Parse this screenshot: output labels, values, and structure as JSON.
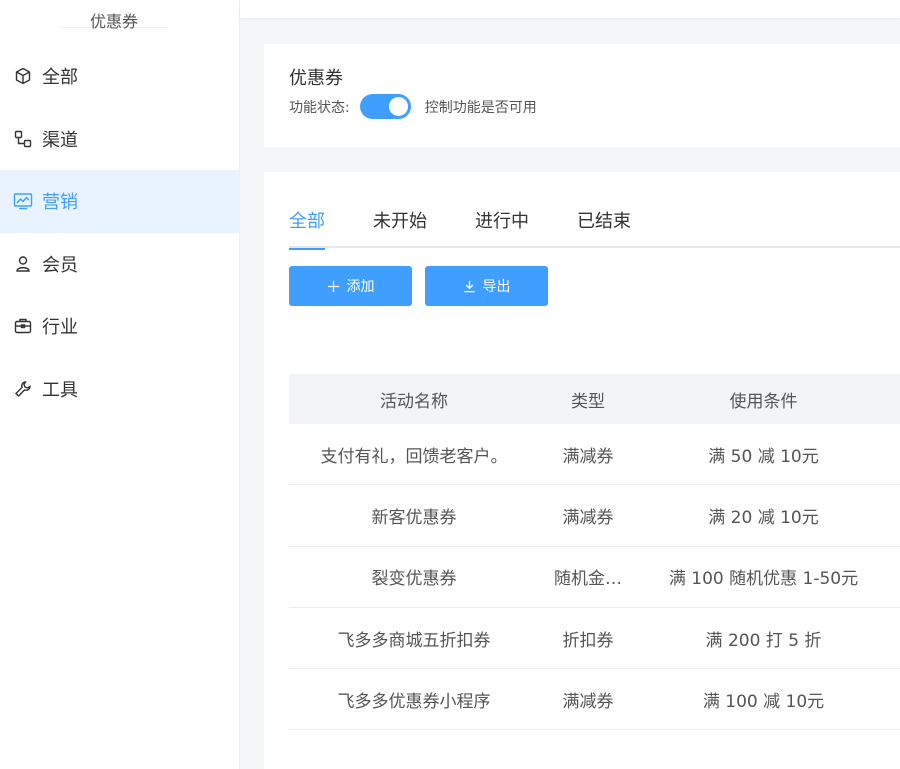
{
  "sidebar": {
    "title": "优惠券",
    "items": [
      {
        "label": "全部",
        "icon": "cube-icon",
        "active": false
      },
      {
        "label": "渠道",
        "icon": "channel-icon",
        "active": false
      },
      {
        "label": "营销",
        "icon": "chart-line-icon",
        "active": true
      },
      {
        "label": "会员",
        "icon": "user-icon",
        "active": false
      },
      {
        "label": "行业",
        "icon": "briefcase-icon",
        "active": false
      },
      {
        "label": "工具",
        "icon": "wrench-icon",
        "active": false
      }
    ]
  },
  "feature": {
    "title": "优惠券",
    "status_label": "功能状态:",
    "toggle_on": true,
    "description": "控制功能是否可用"
  },
  "tabs": [
    "全部",
    "未开始",
    "进行中",
    "已结束"
  ],
  "active_tab": "全部",
  "buttons": {
    "add": "添加",
    "export": "导出"
  },
  "table": {
    "headers": [
      "活动名称",
      "类型",
      "使用条件"
    ],
    "rows": [
      [
        "支付有礼，回馈老客户。",
        "满减券",
        "满 50 减 10元"
      ],
      [
        "新客优惠券",
        "满减券",
        "满 20 减 10元"
      ],
      [
        "裂变优惠券",
        "随机金…",
        "满 100 随机优惠 1-50元"
      ],
      [
        "飞多多商城五折扣券",
        "折扣券",
        "满 200 打 5 折"
      ],
      [
        "飞多多优惠券小程序",
        "满减券",
        "满 100 减 10元"
      ]
    ]
  },
  "colors": {
    "accent": "#409eff",
    "active_bg": "#e8f3ff",
    "header_bg": "#f2f4f7"
  }
}
